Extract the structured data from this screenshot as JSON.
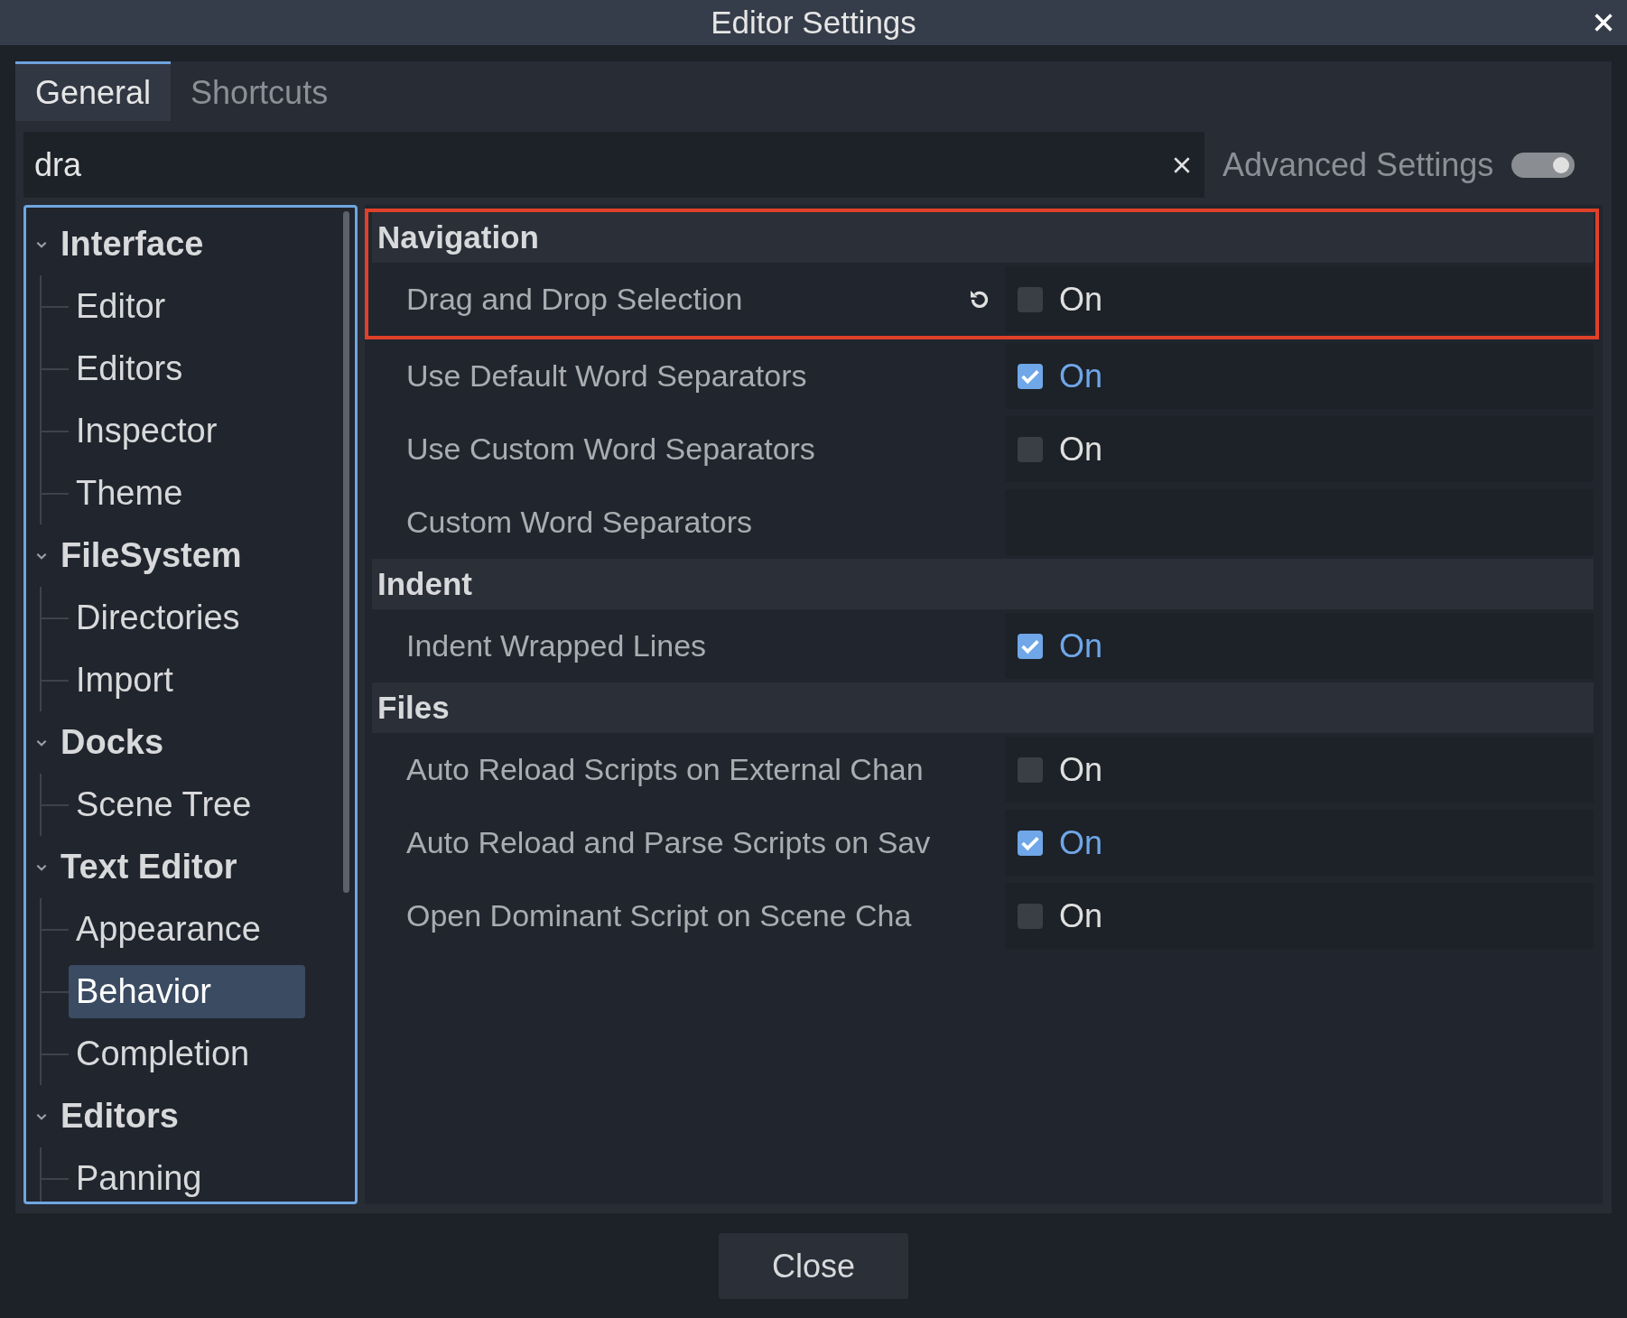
{
  "window": {
    "title": "Editor Settings"
  },
  "tabs": [
    {
      "label": "General",
      "selected": true
    },
    {
      "label": "Shortcuts",
      "selected": false
    }
  ],
  "search": {
    "value": "dra"
  },
  "advanced_settings": {
    "label": "Advanced Settings",
    "on": true
  },
  "tree": [
    {
      "label": "Interface",
      "expanded": true,
      "children": [
        {
          "label": "Editor",
          "selected": false
        },
        {
          "label": "Editors",
          "selected": false
        },
        {
          "label": "Inspector",
          "selected": false
        },
        {
          "label": "Theme",
          "selected": false
        }
      ]
    },
    {
      "label": "FileSystem",
      "expanded": true,
      "children": [
        {
          "label": "Directories",
          "selected": false
        },
        {
          "label": "Import",
          "selected": false
        }
      ]
    },
    {
      "label": "Docks",
      "expanded": true,
      "children": [
        {
          "label": "Scene Tree",
          "selected": false
        }
      ]
    },
    {
      "label": "Text Editor",
      "expanded": true,
      "children": [
        {
          "label": "Appearance",
          "selected": false
        },
        {
          "label": "Behavior",
          "selected": true
        },
        {
          "label": "Completion",
          "selected": false
        }
      ]
    },
    {
      "label": "Editors",
      "expanded": true,
      "children": [
        {
          "label": "Panning",
          "selected": false
        }
      ]
    }
  ],
  "sections": [
    {
      "title": "Navigation",
      "highlighted": true,
      "properties": [
        {
          "label": "Drag and Drop Selection",
          "kind": "checkbox",
          "checked": false,
          "value": "On",
          "revertible": true
        },
        {
          "label": "Use Default Word Separators",
          "kind": "checkbox",
          "checked": true,
          "value": "On",
          "revertible": false
        },
        {
          "label": "Use Custom Word Separators",
          "kind": "checkbox",
          "checked": false,
          "value": "On",
          "revertible": false
        },
        {
          "label": "Custom Word Separators",
          "kind": "text",
          "revertible": false
        }
      ]
    },
    {
      "title": "Indent",
      "highlighted": false,
      "properties": [
        {
          "label": "Indent Wrapped Lines",
          "kind": "checkbox",
          "checked": true,
          "value": "On",
          "revertible": false
        }
      ]
    },
    {
      "title": "Files",
      "highlighted": false,
      "properties": [
        {
          "label": "Auto Reload Scripts on External Chan",
          "kind": "checkbox",
          "checked": false,
          "value": "On",
          "revertible": false
        },
        {
          "label": "Auto Reload and Parse Scripts on Sav",
          "kind": "checkbox",
          "checked": true,
          "value": "On",
          "revertible": false
        },
        {
          "label": "Open Dominant Script on Scene Cha",
          "kind": "checkbox",
          "checked": false,
          "value": "On",
          "revertible": false
        }
      ]
    }
  ],
  "buttons": [
    {
      "label": "Close"
    }
  ]
}
